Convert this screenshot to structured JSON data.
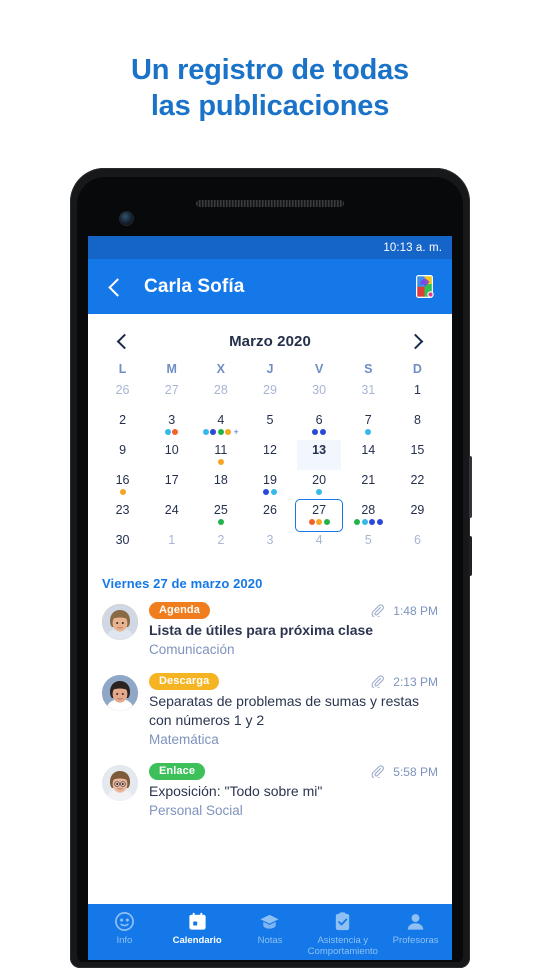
{
  "promo": {
    "line1": "Un registro de todas",
    "line2": "las publicaciones",
    "color": "#1a73c8"
  },
  "phone": {
    "status_bar": {
      "time": "10:13 a. m.",
      "bg": "#1565c8"
    },
    "header": {
      "back_icon": "chevron-left-icon",
      "title": "Carla Sofía",
      "app_icon": "colorful-phone-app-icon",
      "bg": "#1478e8"
    }
  },
  "calendar": {
    "prev_icon": "chevron-left-icon",
    "next_icon": "chevron-right-icon",
    "month_label": "Marzo 2020",
    "dows": [
      "L",
      "M",
      "X",
      "J",
      "V",
      "S",
      "D"
    ],
    "colors": {
      "cyan": "#35b9e8",
      "blue": "#2a49d6",
      "green": "#24b34b",
      "orange": "#f5a623",
      "red_orange": "#f4622c",
      "selected_border": "#1478e8",
      "today_bg": "#f2f6fd"
    },
    "cells": [
      {
        "n": "26",
        "muted": true,
        "dots": []
      },
      {
        "n": "27",
        "muted": true,
        "dots": []
      },
      {
        "n": "28",
        "muted": true,
        "dots": []
      },
      {
        "n": "29",
        "muted": true,
        "dots": []
      },
      {
        "n": "30",
        "muted": true,
        "dots": []
      },
      {
        "n": "31",
        "muted": true,
        "dots": []
      },
      {
        "n": "1",
        "muted": false,
        "dots": []
      },
      {
        "n": "2",
        "muted": false,
        "dots": []
      },
      {
        "n": "3",
        "muted": false,
        "dots": [
          "cyan",
          "red_orange"
        ]
      },
      {
        "n": "4",
        "muted": false,
        "dots": [
          "cyan",
          "blue",
          "green",
          "orange"
        ],
        "plus": true
      },
      {
        "n": "5",
        "muted": false,
        "dots": []
      },
      {
        "n": "6",
        "muted": false,
        "dots": [
          "blue",
          "blue"
        ]
      },
      {
        "n": "7",
        "muted": false,
        "dots": [
          "cyan"
        ]
      },
      {
        "n": "8",
        "muted": false,
        "dots": []
      },
      {
        "n": "9",
        "muted": false,
        "dots": []
      },
      {
        "n": "10",
        "muted": false,
        "dots": []
      },
      {
        "n": "11",
        "muted": false,
        "dots": [
          "orange"
        ]
      },
      {
        "n": "12",
        "muted": false,
        "dots": []
      },
      {
        "n": "13",
        "muted": false,
        "dots": [],
        "today": true
      },
      {
        "n": "14",
        "muted": false,
        "dots": []
      },
      {
        "n": "15",
        "muted": false,
        "dots": []
      },
      {
        "n": "16",
        "muted": false,
        "dots": [
          "orange"
        ]
      },
      {
        "n": "17",
        "muted": false,
        "dots": []
      },
      {
        "n": "18",
        "muted": false,
        "dots": []
      },
      {
        "n": "19",
        "muted": false,
        "dots": [
          "blue",
          "cyan"
        ]
      },
      {
        "n": "20",
        "muted": false,
        "dots": [
          "cyan"
        ]
      },
      {
        "n": "21",
        "muted": false,
        "dots": []
      },
      {
        "n": "22",
        "muted": false,
        "dots": []
      },
      {
        "n": "23",
        "muted": false,
        "dots": []
      },
      {
        "n": "24",
        "muted": false,
        "dots": []
      },
      {
        "n": "25",
        "muted": false,
        "dots": [
          "green"
        ]
      },
      {
        "n": "26",
        "muted": false,
        "dots": []
      },
      {
        "n": "27",
        "muted": false,
        "dots": [
          "red_orange",
          "orange",
          "green"
        ],
        "selected": true
      },
      {
        "n": "28",
        "muted": false,
        "dots": [
          "green",
          "cyan",
          "blue",
          "blue"
        ]
      },
      {
        "n": "29",
        "muted": false,
        "dots": []
      },
      {
        "n": "30",
        "muted": false,
        "dots": []
      },
      {
        "n": "1",
        "muted": true,
        "dots": []
      },
      {
        "n": "2",
        "muted": true,
        "dots": []
      },
      {
        "n": "3",
        "muted": true,
        "dots": []
      },
      {
        "n": "4",
        "muted": true,
        "dots": []
      },
      {
        "n": "5",
        "muted": true,
        "dots": []
      },
      {
        "n": "6",
        "muted": true,
        "dots": []
      }
    ]
  },
  "posts": {
    "date_header": "Viernes 27 de marzo 2020",
    "attachment_icon": "paperclip-icon",
    "items": [
      {
        "badge": "Agenda",
        "badge_color": "#f07d1e",
        "title": "Lista de útiles para próxima clase",
        "bold_title": true,
        "subject": "Comunicación",
        "time": "1:48 PM",
        "avatar_ring": "#f07d1e",
        "avatar_name": "avatar-teacher-1"
      },
      {
        "badge": "Descarga",
        "badge_color": "#f5b421",
        "title": "Separatas  de problemas de sumas y restas con números 1 y 2",
        "bold_title": false,
        "subject": "Matemática",
        "time": "2:13 PM",
        "avatar_ring": "#8fa8c7",
        "avatar_name": "avatar-teacher-2"
      },
      {
        "badge": "Enlace",
        "badge_color": "#3dc05a",
        "title": "Exposición: \"Todo sobre mi\"",
        "bold_title": false,
        "subject": "Personal Social",
        "time": "5:58 PM",
        "avatar_ring": "#d8dee8",
        "avatar_name": "avatar-teacher-3"
      }
    ]
  },
  "bottom_nav": {
    "items": [
      {
        "label": "Info",
        "icon": "info-face-icon",
        "active": false
      },
      {
        "label": "Calendario",
        "icon": "calendar-icon",
        "active": true
      },
      {
        "label": "Notas",
        "icon": "graduation-cap-icon",
        "active": false
      },
      {
        "label": "Asistencia y Comportamiento",
        "icon": "clipboard-check-icon",
        "active": false
      },
      {
        "label": "Profesoras",
        "icon": "person-icon",
        "active": false
      }
    ]
  }
}
